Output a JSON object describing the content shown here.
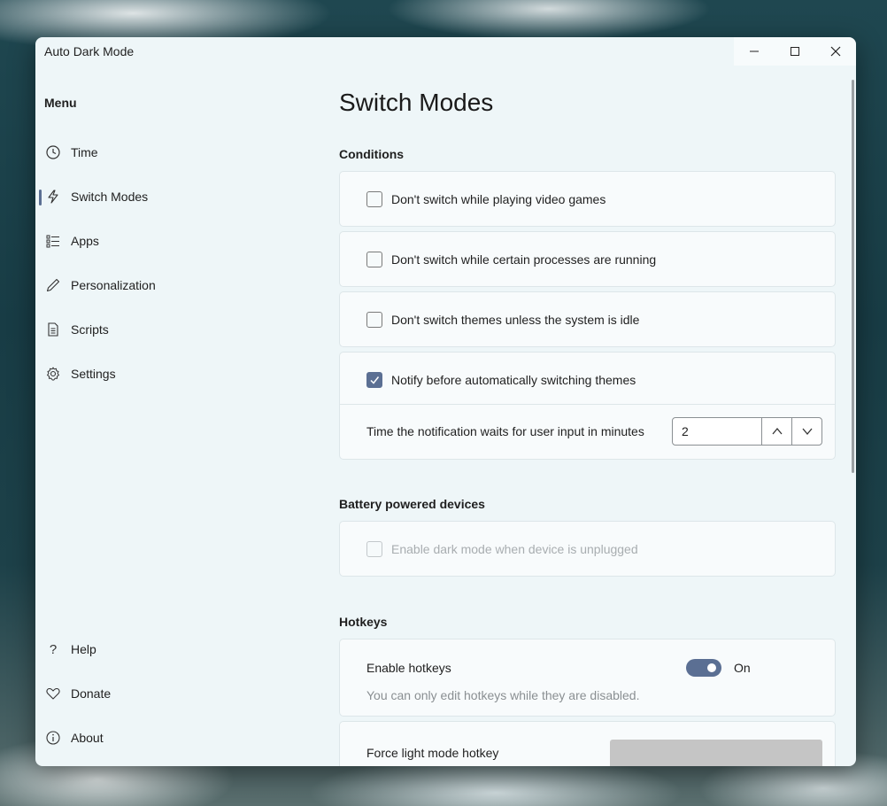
{
  "window": {
    "title": "Auto Dark Mode"
  },
  "titlebar": {
    "minimize_icon": "minimize-icon",
    "maximize_icon": "maximize-icon",
    "close_icon": "close-icon"
  },
  "sidebar": {
    "menu_label": "Menu",
    "items": [
      {
        "label": "Time",
        "icon": "clock-icon"
      },
      {
        "label": "Switch Modes",
        "icon": "lightning-icon",
        "selected": true
      },
      {
        "label": "Apps",
        "icon": "list-icon"
      },
      {
        "label": "Personalization",
        "icon": "pen-icon"
      },
      {
        "label": "Scripts",
        "icon": "document-icon"
      },
      {
        "label": "Settings",
        "icon": "gear-icon"
      }
    ],
    "footer_items": [
      {
        "label": "Help",
        "icon": "question-icon"
      },
      {
        "label": "Donate",
        "icon": "heart-icon"
      },
      {
        "label": "About",
        "icon": "info-icon"
      }
    ]
  },
  "main": {
    "title": "Switch Modes",
    "conditions": {
      "title": "Conditions",
      "options": [
        {
          "label": "Don't switch while playing video games",
          "checked": false
        },
        {
          "label": "Don't switch while certain processes are running",
          "checked": false
        },
        {
          "label": "Don't switch themes unless the system is idle",
          "checked": false
        },
        {
          "label": "Notify before automatically switching themes",
          "checked": true
        }
      ],
      "notify_wait_label": "Time the notification waits for user input in minutes",
      "notify_wait_value": "2"
    },
    "battery": {
      "title": "Battery powered devices",
      "option": {
        "label": "Enable dark mode when device is unplugged",
        "checked": false,
        "disabled": true
      }
    },
    "hotkeys": {
      "title": "Hotkeys",
      "enable_label": "Enable hotkeys",
      "toggle_state": "On",
      "hint": "You can only edit hotkeys while they are disabled.",
      "force_light_label": "Force light mode hotkey"
    }
  },
  "colors": {
    "accent": "#5b6f93",
    "window_bg": "#eef6f8"
  }
}
